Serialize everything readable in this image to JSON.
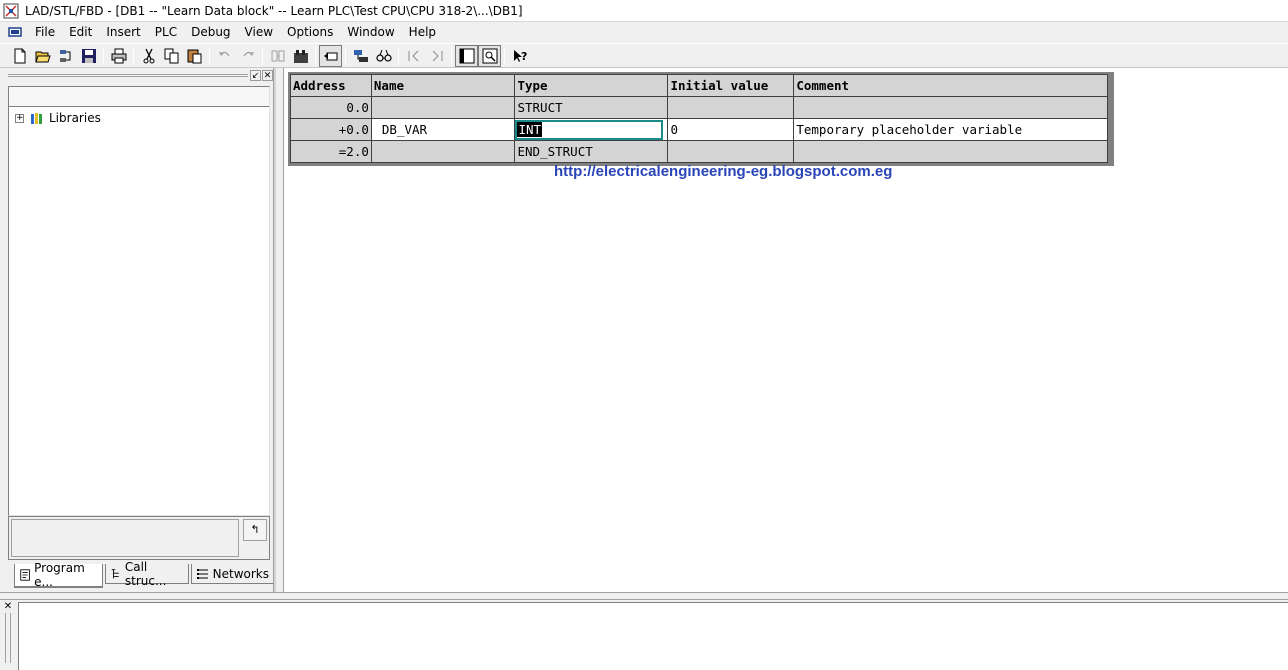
{
  "window": {
    "title": "LAD/STL/FBD  - [DB1 -- \"Learn Data block\" -- Learn PLC\\Test CPU\\CPU 318-2\\...\\DB1]"
  },
  "menu": [
    "File",
    "Edit",
    "Insert",
    "PLC",
    "Debug",
    "View",
    "Options",
    "Window",
    "Help"
  ],
  "toolbar": {
    "buttons": [
      "new-icon",
      "open-icon",
      "accessible-nodes-icon",
      "save-icon",
      "print-icon",
      "cut-icon",
      "copy-icon",
      "paste-icon",
      "undo-icon",
      "redo-icon",
      "download-icon",
      "module-info-icon",
      "back-icon",
      "monitor-icon",
      "glasses-icon",
      "prev-network-icon",
      "next-network-icon",
      "overview-icon",
      "zoom-icon",
      "help-icon"
    ]
  },
  "left_pane": {
    "tree_item": "Libraries",
    "tabs": [
      "Program e...",
      "Call struc...",
      "Networks"
    ]
  },
  "table": {
    "headers": [
      "Address",
      "Name",
      "Type",
      "Initial value",
      "Comment"
    ],
    "rows": [
      {
        "address": "0.0",
        "name": "",
        "type": "STRUCT",
        "initial": "",
        "comment": ""
      },
      {
        "address": "+0.0",
        "name": "DB_VAR",
        "type": "INT",
        "initial": "0",
        "comment": "Temporary placeholder variable"
      },
      {
        "address": "=2.0",
        "name": "",
        "type": "END_STRUCT",
        "initial": "",
        "comment": ""
      }
    ]
  },
  "watermark": "http://electricalengineering-eg.blogspot.com.eg",
  "colors": {
    "accent": "#1a8c8c",
    "watermark": "#2a45b8"
  }
}
